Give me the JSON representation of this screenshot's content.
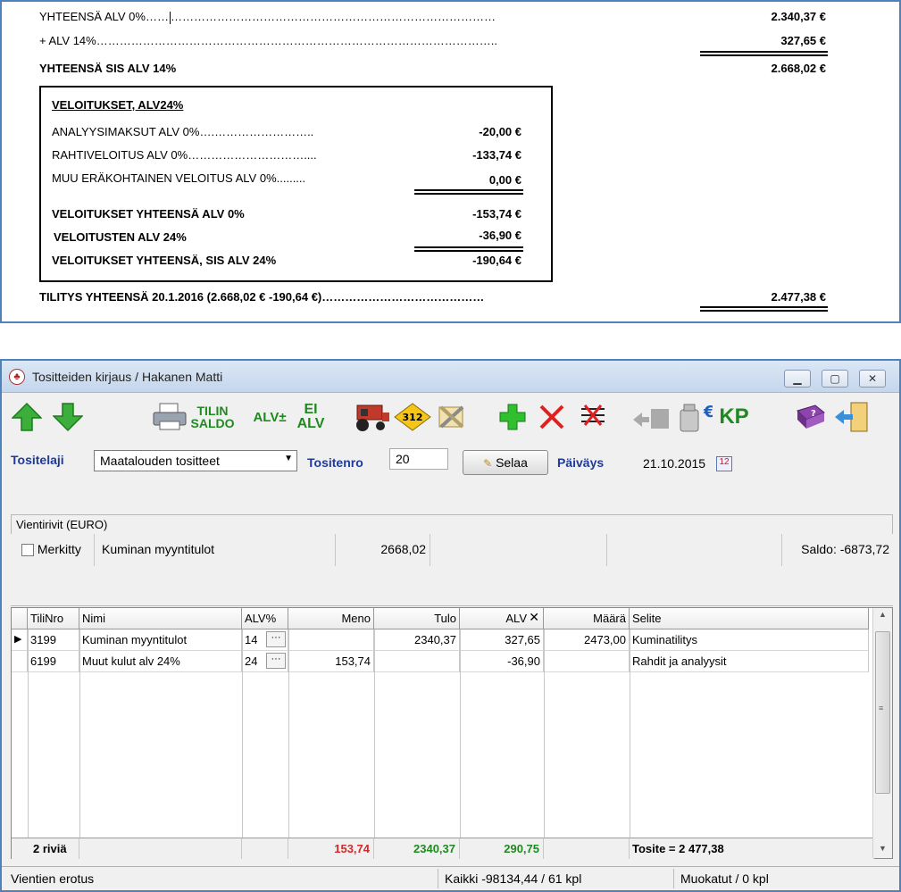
{
  "document": {
    "lines": [
      {
        "label": "YHTEENSÄ ALV 0%……",
        "dots": "…………………………………………………………………………",
        "amount": "2.340,37 €"
      },
      {
        "label": "+ ALV 14%…………………………………………………………………………………………..",
        "amount": "327,65 €"
      },
      {
        "label": "YHTEENSÄ SIS ALV 14%",
        "amount": "2.668,02 €"
      }
    ],
    "box": {
      "title": "VELOITUKSET, ALV24%",
      "items": [
        {
          "label": "ANALYYSIMAKSUT ALV 0%….……………………..",
          "amount": "-20,00 €"
        },
        {
          "label": "RAHTIVELOITUS ALV 0%…………………………....",
          "amount": "-133,74 €"
        },
        {
          "label": "MUU ERÄKOHTAINEN VELOITUS ALV 0%.........",
          "amount": "0,00 €"
        },
        {
          "label": "VELOITUKSET YHTEENSÄ ALV 0%",
          "amount": "-153,74 €"
        },
        {
          "label": "VELOITUSTEN ALV 24%",
          "amount": "-36,90 €"
        },
        {
          "label": "VELOITUKSET YHTEENSÄ, SIS ALV 24%",
          "amount": "-190,64 €"
        }
      ]
    },
    "total": {
      "label": "TILITYS YHTEENSÄ 20.1.2016  (2.668,02 € -190,64 €)……………………………………",
      "amount": "2.477,38 €"
    }
  },
  "app": {
    "title": "Tositteiden kirjaus / Hakanen Matti",
    "toolbar": {
      "tilin_saldo_1": "TILIN",
      "tilin_saldo_2": "SALDO",
      "alv_pm": "ALV±",
      "ei_alv_1": "EI",
      "ei_alv_2": "ALV",
      "badge_312": "312",
      "kp": "KP"
    },
    "form": {
      "tositelaji_label": "Tositelaji",
      "tositelaji_value": "Maatalouden tositteet",
      "tositenro_label": "Tositenro",
      "tositenro_value": "20",
      "selaa": "Selaa",
      "paivays_label": "Päiväys",
      "paivays_value": "21.10.2015"
    },
    "vienti": {
      "group_label": "Vientirivit (EURO)",
      "merkitty": "Merkitty",
      "name": "Kuminan myyntitulot",
      "amount": "2668,02",
      "saldo": "Saldo: -6873,72"
    },
    "grid": {
      "headers": [
        "TiliNro",
        "Nimi",
        "ALV%",
        "Meno",
        "Tulo",
        "ALV",
        "Määrä",
        "Selite"
      ],
      "rows": [
        [
          "3199",
          "Kuminan myyntitulot",
          "14",
          "",
          "2340,37",
          "327,65",
          "2473,00",
          "Kuminatilitys"
        ],
        [
          "6199",
          "Muut kulut  alv 24%",
          "24",
          "153,74",
          "",
          "-36,90",
          "",
          "Rahdit ja analyysit"
        ]
      ],
      "footer": {
        "rows": "2 riviä",
        "meno": "153,74",
        "tulo": "2340,37",
        "alv": "290,75",
        "tosite": "Tosite = 2 477,38"
      }
    },
    "status": {
      "left": "Vientien erotus",
      "middle": "Kaikki -98134,44 / 61 kpl",
      "right": "Muokatut  / 0 kpl"
    },
    "colors": {
      "meno": "#d22a2a",
      "tulo": "#1f8a1f",
      "alv": "#1f8a1f"
    }
  }
}
